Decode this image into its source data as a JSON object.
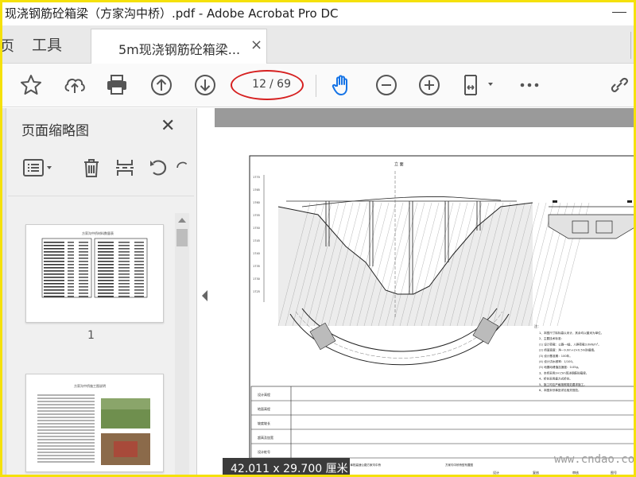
{
  "window": {
    "title": "现浇钢筋砼箱梁（方家沟中桥）.pdf - Adobe Acrobat Pro DC"
  },
  "tabs": {
    "cut_label": "页",
    "tools_label": "工具",
    "doc_label": "5m现浇钢筋砼箱梁...",
    "close_glyph": "×"
  },
  "toolbar": {
    "icons": [
      "star-icon",
      "upload-cloud-icon",
      "print-icon",
      "page-up-icon",
      "page-down-icon",
      "hand-tool-icon",
      "zoom-out-icon",
      "zoom-in-icon",
      "page-fit-icon",
      "more-icon",
      "link-icon"
    ],
    "current_page": "12",
    "total_pages": "/ 69",
    "accent": "#1473e6",
    "highlight": "#d62020"
  },
  "panel": {
    "title": "页面缩略图",
    "close_glyph": "✕",
    "thumb1_number": "1",
    "thumb1_heading": "方家沟中桥材料数量表",
    "thumb2_heading": "方家沟中桥施工图说明"
  },
  "drawing": {
    "section_label": "立 面",
    "elevation_labels": [
      "1770",
      "1765",
      "1760",
      "1755",
      "1750",
      "1745",
      "1740",
      "1735",
      "1730",
      "1725"
    ],
    "notes_label": "注：",
    "notes_lines": [
      "1、本图尺寸除标高以米计，其余均以厘米为单位。",
      "2、主要技术标准：",
      "(1) 设计荷载：公路—I级，人群荷载3.0kN/m²。",
      "(2) 桥面宽度：净—9.0m+2×0.5m防撞墙。",
      "(3) 设计基准期：100年。",
      "(4) 设计洪水频率：1/100。",
      "(5) 地震动峰值加速度：0.05g。",
      "3、本桥采用3×15m现浇钢筋砼箱梁。",
      "4、桥台采用重力式桥台。",
      "5、施工时应严格按照规范要求施工。",
      "6、本图未尽事宜详见相关规范。"
    ],
    "title_block": {
      "company": "中交远洲交通科技集团有限公司",
      "project": "永城至阜阳高速公路方家沟中桥",
      "drawing_title": "方家沟中桥桥型布置图",
      "design": "设计",
      "review": "复核",
      "audit": "审核",
      "drawing_no": "图号",
      "row_labels": [
        "设计高程",
        "地面高程",
        "坡度坡长",
        "超高及加宽",
        "设计桩号"
      ]
    }
  },
  "status": {
    "page_size": "42.011 x 29.700 厘米"
  },
  "watermark": "www.cndao.com"
}
